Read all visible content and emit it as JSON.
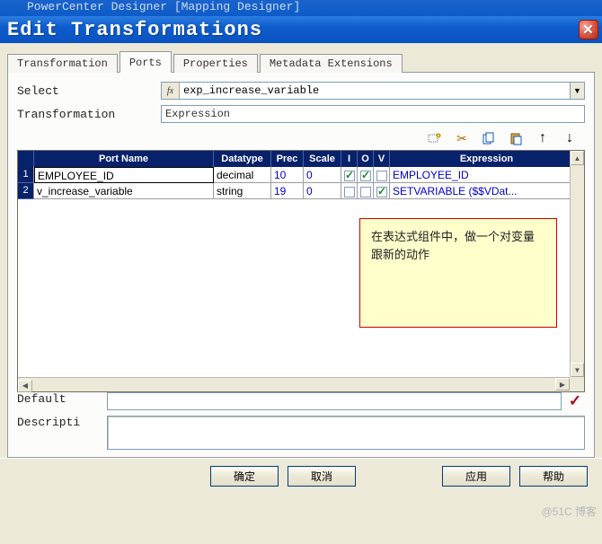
{
  "parent_title_fragment": "PowerCenter Designer    [Mapping Designer]",
  "window_title": "Edit Transformations",
  "tabs": {
    "t0": "Transformation",
    "t1": "Ports",
    "t2": "Properties",
    "t3": "Metadata Extensions",
    "active": "t1"
  },
  "labels": {
    "select": "Select",
    "transformation": "Transformation",
    "default": "Default",
    "description": "Descripti"
  },
  "select_value": "exp_increase_variable",
  "fx_symbol": "fx",
  "transformation_type": "Expression",
  "toolbar": {
    "new": "new-port",
    "cut": "cut",
    "copy": "copy",
    "paste": "paste",
    "up": "move-up",
    "down": "move-down"
  },
  "grid": {
    "headers": {
      "rownum": "",
      "port": "Port Name",
      "datatype": "Datatype",
      "prec": "Prec",
      "scale": "Scale",
      "i": "I",
      "o": "O",
      "v": "V",
      "expr": "Expression"
    },
    "rows": [
      {
        "n": "1",
        "port": "EMPLOYEE_ID",
        "datatype": "decimal",
        "prec": "10",
        "scale": "0",
        "i": true,
        "o": true,
        "v": false,
        "expr": "EMPLOYEE_ID",
        "selected": true
      },
      {
        "n": "2",
        "port": "v_increase_variable",
        "datatype": "string",
        "prec": "19",
        "scale": "0",
        "i": false,
        "o": false,
        "v": true,
        "expr": "SETVARIABLE ($$VDat...",
        "selected": false
      }
    ]
  },
  "annotation": "在表达式组件中，做一个对变量跟新的动作",
  "buttons": {
    "ok": "确定",
    "cancel": "取消",
    "apply": "应用",
    "help": "帮助"
  },
  "watermark": "@51C 博客"
}
